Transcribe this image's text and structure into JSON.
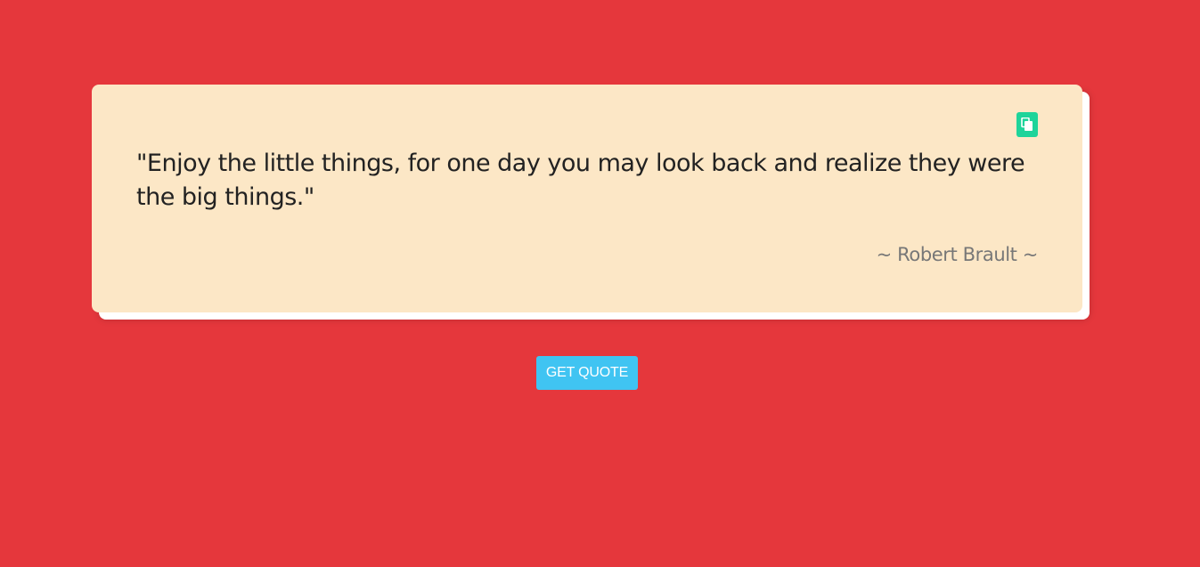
{
  "quote": {
    "text": "\"Enjoy the little things, for one day you may look back and realize they were the big things.\"",
    "author": "~ Robert Brault ~",
    "copy_icon": "copy-icon"
  },
  "actions": {
    "get_quote_label": "GET QUOTE"
  },
  "colors": {
    "background": "#e5373c",
    "card": "#fce7c6",
    "copy_button": "#1ed49a",
    "get_quote_button": "#40c4f2"
  }
}
